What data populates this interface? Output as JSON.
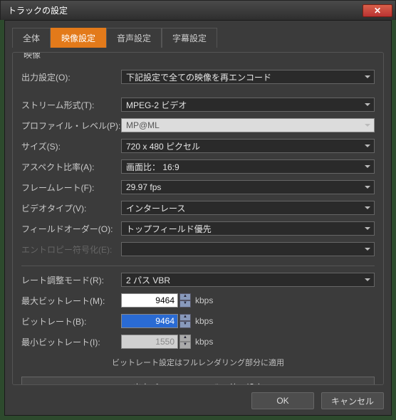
{
  "window": {
    "title": "トラックの設定"
  },
  "tabs": {
    "all": "全体",
    "video": "映像設定",
    "audio": "音声設定",
    "subtitle": "字幕設定"
  },
  "frame": {
    "title": "映像"
  },
  "labels": {
    "output": "出力設定(O):",
    "stream": "ストリーム形式(T):",
    "profile": "プロファイル・レベル(P):",
    "size": "サイズ(S):",
    "aspect": "アスペクト比率(A):",
    "fps": "フレームレート(F):",
    "vtype": "ビデオタイプ(V):",
    "field": "フィールドオーダー(O):",
    "entropy": "エントロピー符号化(E):",
    "ratemode": "レート調整モード(R):",
    "maxbr": "最大ビットレート(M):",
    "bitrate": "ビットレート(B):",
    "minbr": "最小ビットレート(I):"
  },
  "values": {
    "output": "下記設定で全ての映像を再エンコード",
    "stream": "MPEG-2 ビデオ",
    "profile": "MP@ML",
    "size": "720 x 480 ピクセル",
    "aspect": "画面比： 16:9",
    "fps": "29.97 fps",
    "vtype": "インターレース",
    "field": "トップフィールド優先",
    "entropy": "",
    "ratemode": "2 パス VBR",
    "maxbr": "9464",
    "bitrate": "9464",
    "minbr": "1550"
  },
  "units": {
    "kbps": "kbps"
  },
  "note": "ビットレート設定はフルレンダリング部分に適用",
  "bigbtn": "出力パフォーマンス/その他の設定",
  "footer": {
    "ok": "OK",
    "cancel": "キャンセル"
  }
}
